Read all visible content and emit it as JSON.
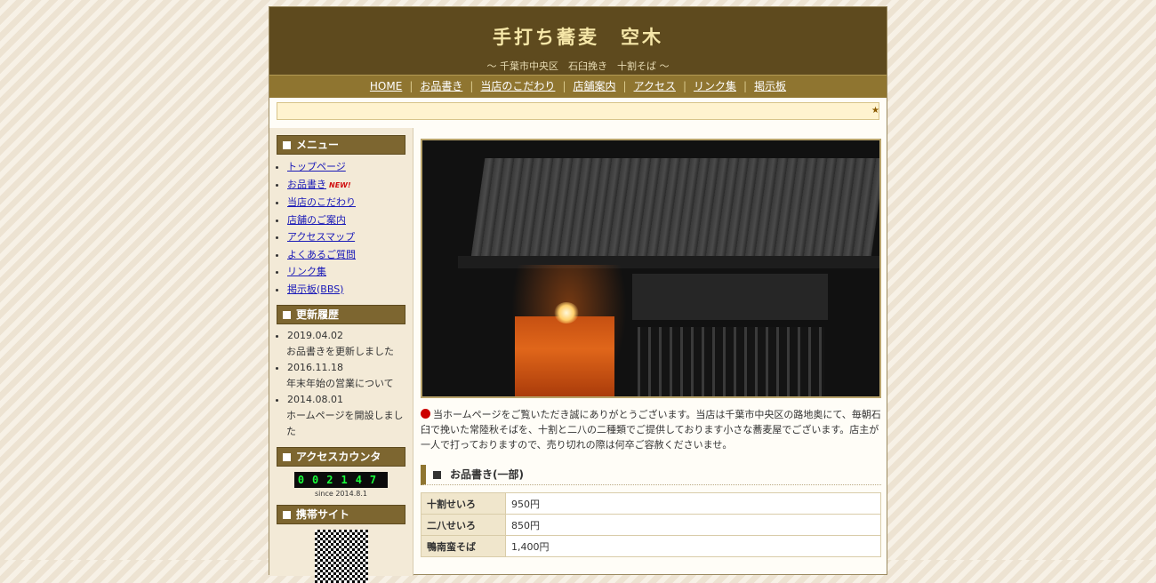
{
  "header": {
    "title": "手打ち蕎麦　空木",
    "subtitle": "～ 千葉市中央区　石臼挽き　十割そば ～"
  },
  "nav": [
    "HOME",
    "お品書き",
    "当店のこだわり",
    "店舗案内",
    "アクセス",
    "リンク集",
    "掲示板"
  ],
  "sidebar": {
    "menu_heading": "メニュー",
    "menu_items": [
      "トップページ",
      "お品書き",
      "当店のこだわり",
      "店舗のご案内",
      "アクセスマップ",
      "よくあるご質問",
      "リンク集",
      "掲示板(BBS)"
    ],
    "new_badge": "NEW!",
    "updates_heading": "更新履歴",
    "updates": [
      {
        "date": "2019.04.02",
        "text": "お品書きを更新しました"
      },
      {
        "date": "2016.11.18",
        "text": "年末年始の営業について"
      },
      {
        "date": "2014.08.01",
        "text": "ホームページを開設しました"
      }
    ],
    "counter_heading": "アクセスカウンタ",
    "counter_value": "002147",
    "counter_since": "since 2014.8.1",
    "mobile_heading": "携帯サイト"
  },
  "main": {
    "intro": "当ホームページをご覧いただき誠にありがとうございます。当店は千葉市中央区の路地奥にて、毎朝石臼で挽いた常陸秋そばを、十割と二八の二種類でご提供しております小さな蕎麦屋でございます。店主が一人で打っておりますので、売り切れの際は何卒ご容赦くださいませ。",
    "menu_heading": "お品書き(一部)",
    "menu_items": [
      {
        "name": "十割せいろ",
        "price": "950円"
      },
      {
        "name": "二八せいろ",
        "price": "850円"
      },
      {
        "name": "鴨南蛮そば",
        "price": "1,400円"
      }
    ]
  }
}
